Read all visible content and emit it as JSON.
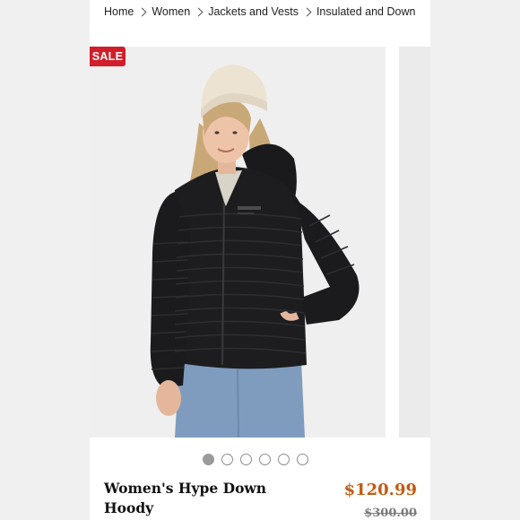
{
  "breadcrumb": {
    "items": [
      "Home",
      "Women",
      "Jackets and Vests",
      "Insulated and Down"
    ]
  },
  "badge": {
    "label": "SALE",
    "color": "#d01f2b"
  },
  "carousel": {
    "total_slides": 6,
    "active_index": 0,
    "image_subject": "woman-in-black-down-hoody-icon"
  },
  "product": {
    "title": "Women's Hype Down Hoody",
    "sale_price": "$120.99",
    "original_price": "$300.00",
    "price_color": "#c45a12"
  }
}
